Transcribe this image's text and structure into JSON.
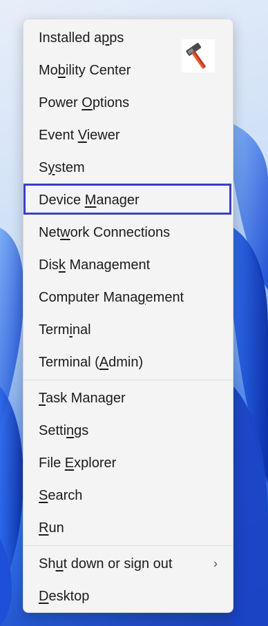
{
  "menu_items": [
    {
      "pre": "Installed a",
      "mn": "p",
      "post": "ps"
    },
    {
      "pre": "Mo",
      "mn": "b",
      "post": "ility Center"
    },
    {
      "pre": "Power ",
      "mn": "O",
      "post": "ptions"
    },
    {
      "pre": "Event ",
      "mn": "V",
      "post": "iewer"
    },
    {
      "pre": "S",
      "mn": "y",
      "post": "stem"
    },
    {
      "pre": "Device ",
      "mn": "M",
      "post": "anager"
    },
    {
      "pre": "Net",
      "mn": "w",
      "post": "ork Connections"
    },
    {
      "pre": "Dis",
      "mn": "k",
      "post": " Management"
    },
    {
      "pre": "Computer Mana",
      "mn": "g",
      "post": "ement"
    },
    {
      "pre": "Term",
      "mn": "i",
      "post": "nal"
    },
    {
      "pre": "Terminal (",
      "mn": "A",
      "post": "dmin)"
    },
    {
      "pre": "",
      "mn": "T",
      "post": "ask Manager"
    },
    {
      "pre": "Setti",
      "mn": "n",
      "post": "gs"
    },
    {
      "pre": "File ",
      "mn": "E",
      "post": "xplorer"
    },
    {
      "pre": "",
      "mn": "S",
      "post": "earch"
    },
    {
      "pre": "",
      "mn": "R",
      "post": "un"
    },
    {
      "pre": "Sh",
      "mn": "u",
      "post": "t down or sign out"
    },
    {
      "pre": "",
      "mn": "D",
      "post": "esktop"
    }
  ],
  "submenu_chevron": "›",
  "highlighted_item": "Device Manager",
  "colors": {
    "highlight_border": "#3b3fbf",
    "menu_background": "#f4f4f4",
    "wallpaper_blue": "#1f5fe6"
  },
  "icons": {
    "corner_badge": "hammer-icon"
  }
}
